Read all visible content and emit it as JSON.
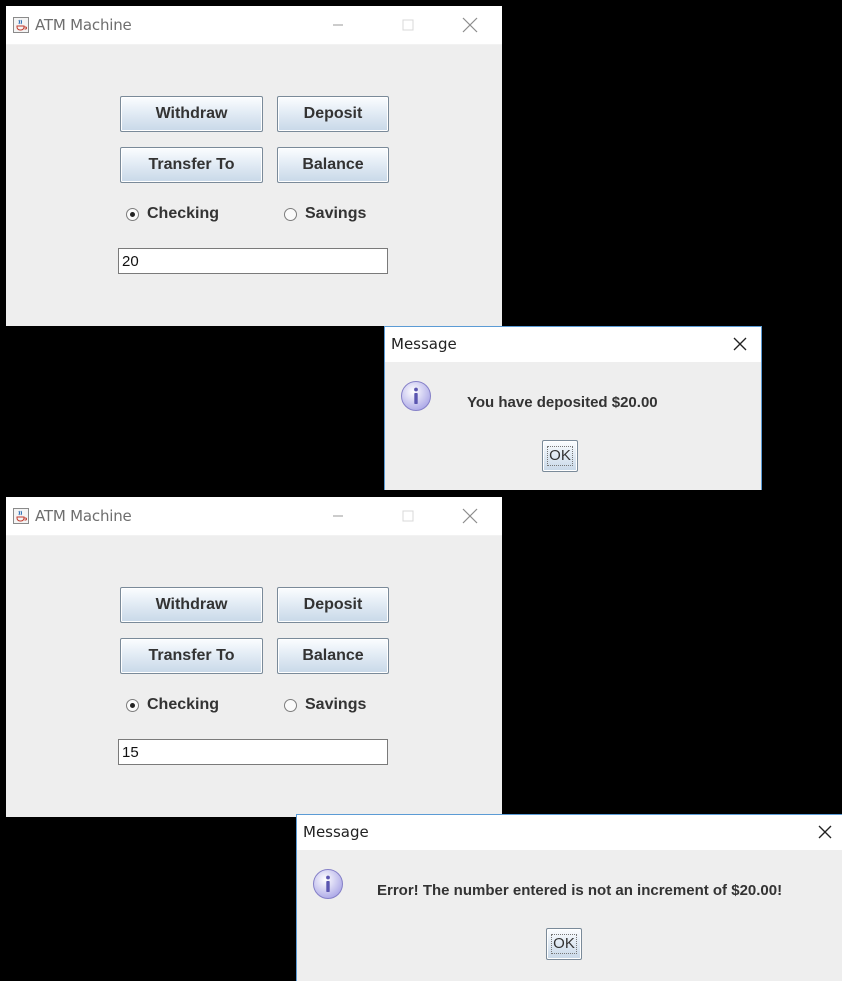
{
  "screenshots": [
    {
      "window": {
        "title": "ATM Machine",
        "buttons": {
          "withdraw": "Withdraw",
          "deposit": "Deposit",
          "transfer": "Transfer To",
          "balance": "Balance"
        },
        "radios": {
          "checking": "Checking",
          "savings": "Savings",
          "selected": "Checking"
        },
        "amount_value": "20"
      },
      "dialog": {
        "title": "Message",
        "message": "You have deposited $20.00",
        "ok_label": "OK"
      }
    },
    {
      "window": {
        "title": "ATM Machine",
        "buttons": {
          "withdraw": "Withdraw",
          "deposit": "Deposit",
          "transfer": "Transfer To",
          "balance": "Balance"
        },
        "radios": {
          "checking": "Checking",
          "savings": "Savings",
          "selected": "Checking"
        },
        "amount_value": "15"
      },
      "dialog": {
        "title": "Message",
        "message": "Error! The number entered is not an increment of $20.00!",
        "ok_label": "OK"
      }
    }
  ],
  "icons": {
    "app": "java-cup-icon",
    "info": "info-icon",
    "minimize": "minimize-icon",
    "maximize": "maximize-icon",
    "close": "close-icon"
  },
  "colors": {
    "background": "#000000",
    "window": "#eeeeee",
    "titlebar": "#ffffff",
    "dialog_border": "#5b9bd5",
    "info_icon": "#b3b0e8"
  }
}
